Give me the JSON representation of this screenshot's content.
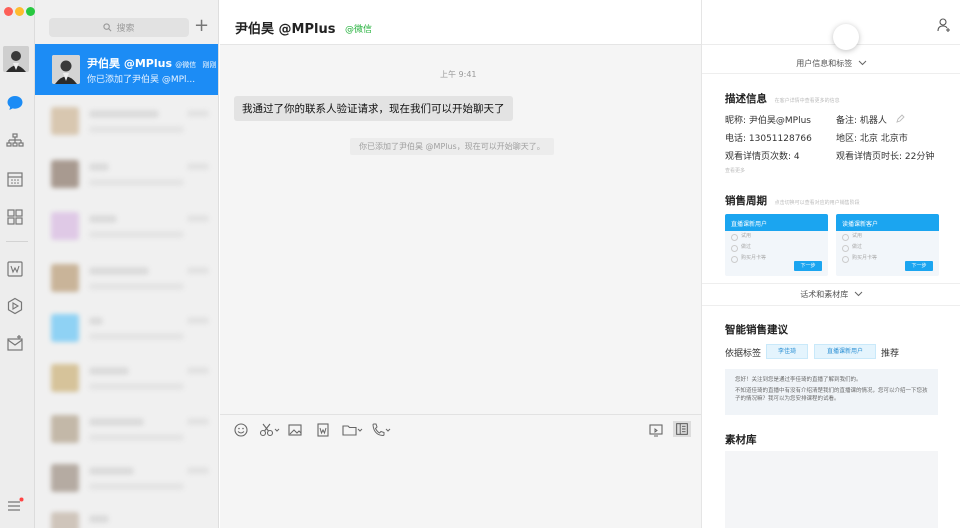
{
  "search": {
    "placeholder": "搜索"
  },
  "active_session": {
    "name": "尹伯昊 @MPlus",
    "channel": "@微信",
    "time": "刚刚",
    "preview": "你已添加了尹伯昊 @MPl..."
  },
  "chat": {
    "title": "尹伯昊 @MPlus",
    "channel": "@微信",
    "time": "上午 9:41",
    "message": "我通过了你的联系人验证请求，现在我们可以开始聊天了",
    "system_message": "你已添加了尹伯昊 @MPlus，现在可以开始聊天了。"
  },
  "panel": {
    "user_info_toggle": "用户信息和标签",
    "desc_title": "描述信息",
    "desc_hint": "在客户详情中查看更多的信息",
    "nickname": "昵称: 尹伯昊@MPlus",
    "remark": "备注: 机器人",
    "phone": "电话: 13051128766",
    "region": "地区: 北京 北京市",
    "view_count": "观看详情页次数: 4",
    "view_duration": "观看详情页时长: 22分钟",
    "more_tiny": "查看更多",
    "sales_title": "销售周期",
    "sales_hint": "点击切换可以查看对应的用户销售阶段",
    "stage_a": {
      "title": "直播课新用户",
      "rows": [
        "试用",
        "做过",
        "购买月卡等"
      ],
      "next": "下一步"
    },
    "stage_b": {
      "title": "读播课新客户",
      "rows": [
        "试用",
        "做过",
        "购买月卡等"
      ],
      "next": "下一步"
    },
    "scripts_toggle": "话术和素材库",
    "smart_title": "智能销售建议",
    "tag_label": "依据标签",
    "tag1": "李佳琦",
    "tag2": "直播课新用户",
    "recommend": "推荐",
    "suggest_1": "您好！关注到您是通过李佳琦的直播了解到我们的。",
    "suggest_2": "不知道佳琦的直播中有没有介绍清楚我们的直播课的情况，您可以介绍一下您孩子的情况嘛？我可以为您安排课程的试看。",
    "material_title": "素材库"
  },
  "colors": {
    "accent": "#1c8cf5",
    "wechat_green": "#23b13b",
    "stage_blue": "#1ba5f0"
  },
  "icons": [
    "chat-icon",
    "contacts-icon",
    "calendar-icon",
    "apps-icon",
    "doc-icon",
    "cube-icon",
    "mail-icon",
    "menu-icon",
    "search-icon",
    "plus-icon",
    "emoji-icon",
    "scissors-icon",
    "image-icon",
    "file-icon",
    "folder-icon",
    "phone-icon",
    "screen-icon",
    "sidebar-toggle-icon",
    "add-person-icon",
    "edit-icon",
    "chevron-down-icon"
  ]
}
